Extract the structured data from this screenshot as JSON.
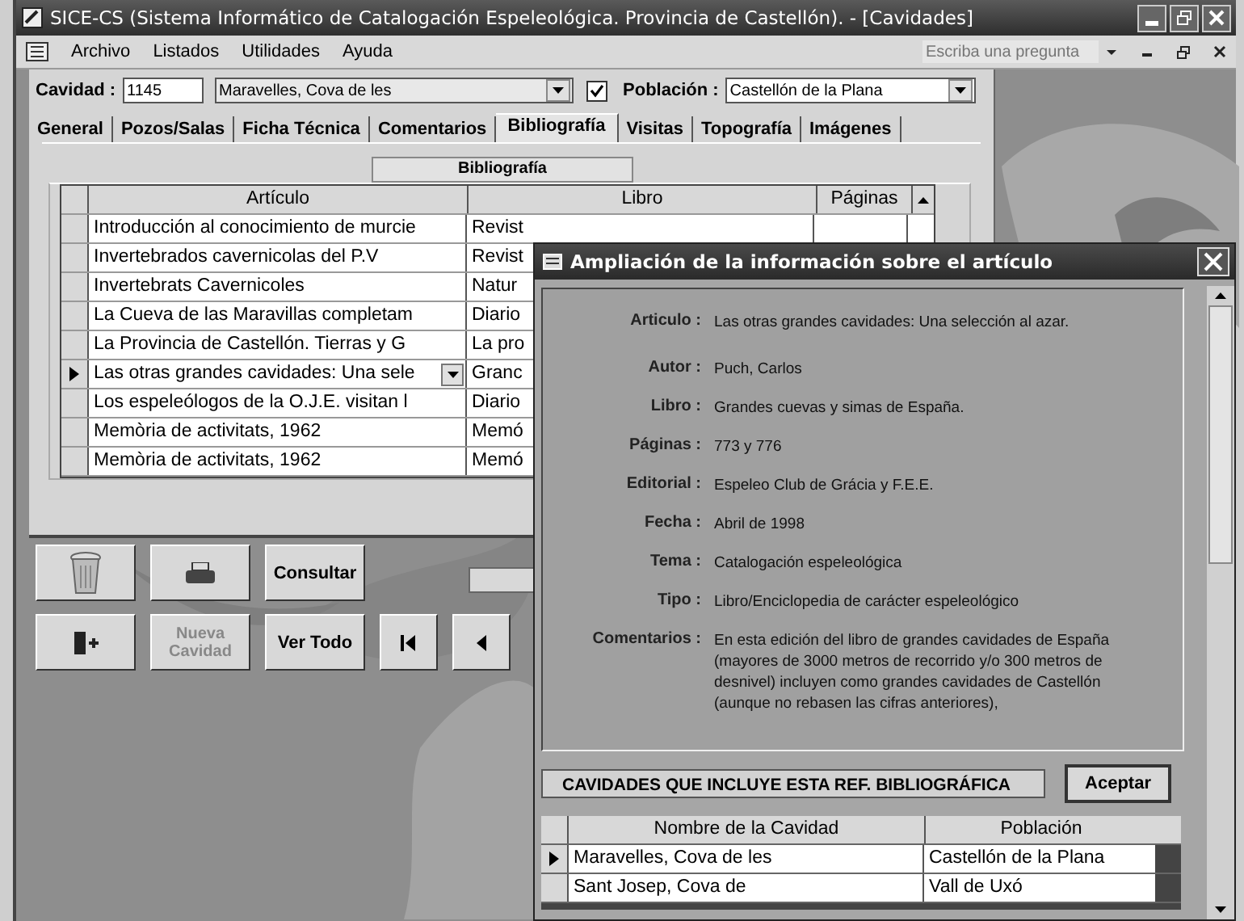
{
  "window": {
    "title": "SICE-CS (Sistema Informático de Catalogación Espeleológica.  Provincia de Castellón). - [Cavidades]"
  },
  "menu": [
    "Archivo",
    "Listados",
    "Utilidades",
    "Ayuda"
  ],
  "help_search": {
    "placeholder": "Escriba una pregunta"
  },
  "record": {
    "cavidad_label": "Cavidad :",
    "cavidad_id": "1145",
    "cavidad_name": "Maravelles, Cova de les",
    "checked": true,
    "poblacion_label": "Población :",
    "poblacion": "Castellón de la Plana"
  },
  "tabs": [
    {
      "label": "General",
      "selected": false
    },
    {
      "label": "Pozos/Salas",
      "selected": false
    },
    {
      "label": "Ficha Técnica",
      "selected": false
    },
    {
      "label": "Comentarios",
      "selected": false
    },
    {
      "label": "Bibliografía",
      "selected": true
    },
    {
      "label": "Visitas",
      "selected": false
    },
    {
      "label": "Topografía",
      "selected": false
    },
    {
      "label": "Imágenes",
      "selected": false
    }
  ],
  "section_caption": "Bibliografía",
  "table": {
    "columns": [
      "Artículo",
      "Libro",
      "Páginas"
    ],
    "rows": [
      {
        "articulo": "Introducción al conocimiento de murcie",
        "libro": "Revist",
        "selected": false
      },
      {
        "articulo": "Invertebrados cavernicolas del P.V",
        "libro": "Revist",
        "selected": false
      },
      {
        "articulo": "Invertebrats Cavernicoles",
        "libro": "Natur",
        "selected": false
      },
      {
        "articulo": "La Cueva de las Maravillas completam",
        "libro": "Diario",
        "selected": false
      },
      {
        "articulo": "La Provincia de Castellón.  Tierras y G",
        "libro": "La pro",
        "selected": false
      },
      {
        "articulo": "Las otras grandes cavidades: Una sele",
        "libro": "Granc",
        "selected": true
      },
      {
        "articulo": "Los espeleólogos de la O.J.E. visitan l",
        "libro": "Diario",
        "selected": false
      },
      {
        "articulo": "Memòria de activitats, 1962",
        "libro": "Memó",
        "selected": false
      },
      {
        "articulo": "Memòria de activitats, 1962",
        "libro": "Memó",
        "selected": false
      }
    ]
  },
  "buttons": [
    {
      "kind": "trash"
    },
    {
      "kind": "printer"
    },
    {
      "kind": "text",
      "label": "Consultar",
      "disabled": false
    },
    {
      "kind": "exit"
    },
    {
      "kind": "text",
      "label": "Nueva Cavidad",
      "disabled": true
    },
    {
      "kind": "text",
      "label": "Ver Todo",
      "disabled": false
    },
    {
      "kind": "first"
    },
    {
      "kind": "prev"
    }
  ],
  "dialog": {
    "title": "Ampliación de la información sobre el artículo",
    "fields": [
      {
        "label": "Articulo :",
        "value": "Las otras grandes cavidades: Una selección al azar."
      },
      {
        "label": "Autor :",
        "value": "Puch, Carlos"
      },
      {
        "label": "Libro :",
        "value": "Grandes cuevas y simas de España."
      },
      {
        "label": "Páginas :",
        "value": "773 y 776"
      },
      {
        "label": "Editorial :",
        "value": "Espeleo Club de Grácia y F.E.E."
      },
      {
        "label": "Fecha :",
        "value": "Abril de 1998"
      },
      {
        "label": "Tema :",
        "value": "Catalogación espeleológica"
      },
      {
        "label": "Tipo :",
        "value": "Libro/Enciclopedia de carácter espeleológico"
      },
      {
        "label": "Comentarios :",
        "value": "En esta edición del libro de grandes cavidades de España (mayores de 3000 metros de recorrido y/o 300 metros de desnivel) incluyen como grandes cavidades de Castellón (aunque no rebasen las cifras anteriores),"
      }
    ],
    "caption": "CAVIDADES QUE INCLUYE ESTA REF. BIBLIOGRÁFICA",
    "accept_button": "Aceptar",
    "table": {
      "columns": [
        "Nombre de la Cavidad",
        "Población"
      ],
      "rows": [
        {
          "nombre": "Maravelles, Cova de les",
          "poblacion": "Castellón de la Plana",
          "selected": true
        },
        {
          "nombre": "Sant Josep, Cova de",
          "poblacion": "Vall de Uxó",
          "selected": false
        }
      ]
    }
  }
}
